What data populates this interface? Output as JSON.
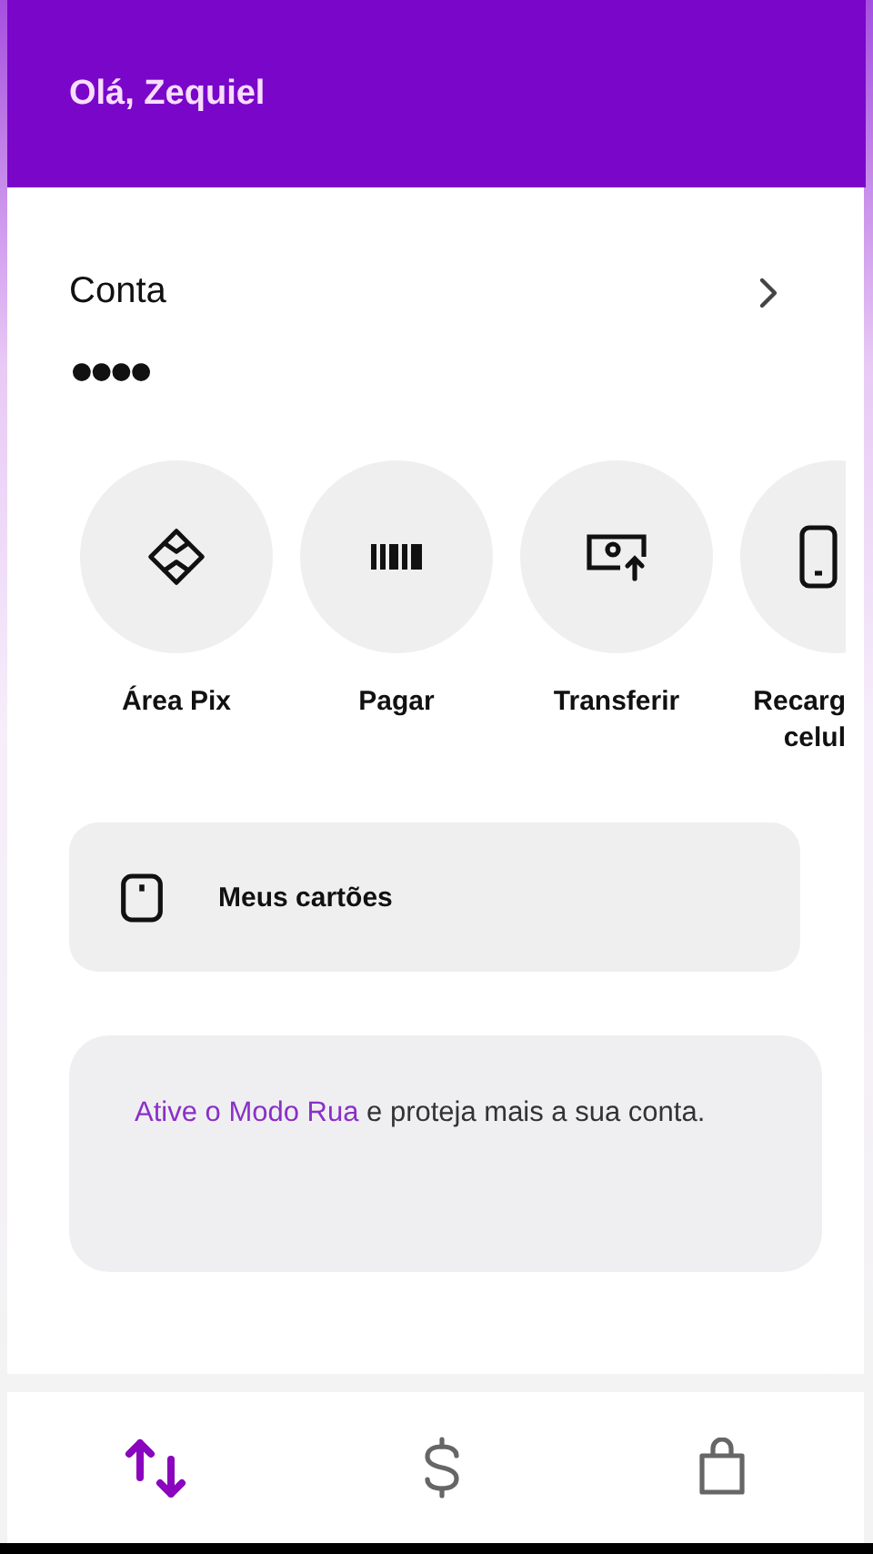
{
  "header": {
    "greeting": "Olá, Zequiel"
  },
  "account": {
    "title": "Conta",
    "balance": "●●●●"
  },
  "actions": [
    {
      "kind": "pix",
      "label": "Área Pix"
    },
    {
      "kind": "barcode",
      "label": "Pagar"
    },
    {
      "kind": "transfer",
      "label": "Transferir"
    },
    {
      "kind": "phone",
      "label": "Recarg\ncelul"
    }
  ],
  "cards_link": {
    "label": "Meus cartões"
  },
  "promo": {
    "link": "Ative o Modo Rua",
    "text": " e proteja mais a sua conta."
  },
  "nav": [
    {
      "kind": "transactions",
      "selected": true
    },
    {
      "kind": "money",
      "selected": false
    },
    {
      "kind": "shop",
      "selected": false
    }
  ]
}
